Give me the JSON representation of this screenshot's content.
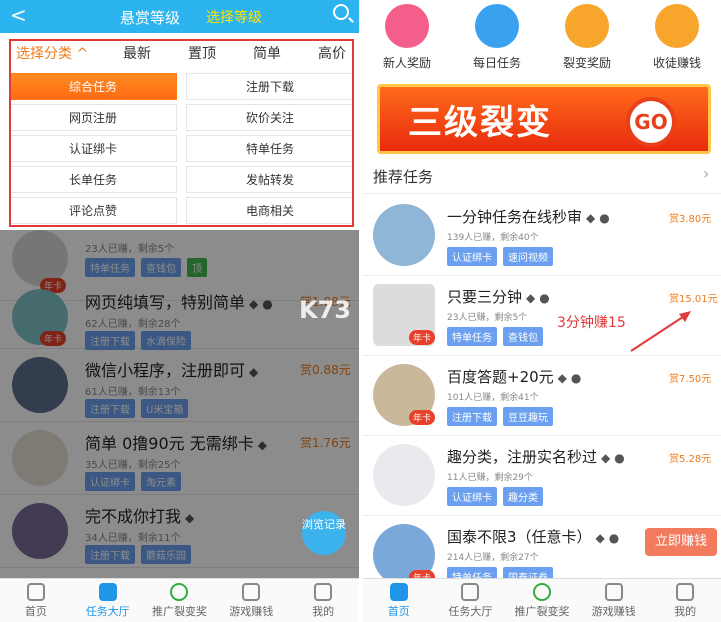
{
  "left": {
    "header": {
      "back": "<",
      "title": "悬赏等级",
      "sub": "选择等级"
    },
    "sort": {
      "category": "选择分类 ^",
      "items": [
        "最新",
        "置顶",
        "简单",
        "高价"
      ]
    },
    "categories": [
      "综合任务",
      "注册下载",
      "网页注册",
      "砍价关注",
      "认证绑卡",
      "特单任务",
      "长单任务",
      "发帖转发",
      "评论点赞",
      "电商相关"
    ],
    "tasks": [
      {
        "name": "",
        "meta": "23人已赚，剩余5个",
        "reward": "",
        "tags": [
          "特单任务",
          "查钱包",
          "顶"
        ],
        "badge": "年卡"
      },
      {
        "name": "网页纯填写，特别简单",
        "meta": "62人已赚，剩余28个",
        "reward": "赏1.88元",
        "tags": [
          "注册下载",
          "水滴保险"
        ],
        "badge": "年卡"
      },
      {
        "name": "微信小程序，注册即可",
        "meta": "61人已赚，剩余13个",
        "reward": "赏0.88元",
        "tags": [
          "注册下载",
          "U米宝箱"
        ],
        "badge": ""
      },
      {
        "name": "简单 0撸90元 无需绑卡",
        "meta": "35人已赚，剩余25个",
        "reward": "赏1.76元",
        "tags": [
          "认证绑卡",
          "淘元素"
        ],
        "badge": ""
      },
      {
        "name": "完不成你打我",
        "meta": "34人已赚，剩余11个",
        "reward": "",
        "tags": [
          "注册下载",
          "蘑菇乐园"
        ],
        "badge": ""
      }
    ],
    "float_button": "浏览记录",
    "tabbar": [
      "首页",
      "任务大厅",
      "推广裂变奖",
      "游戏赚钱",
      "我的"
    ]
  },
  "right": {
    "icons": [
      "新人奖励",
      "每日任务",
      "裂变奖励",
      "收徒赚钱"
    ],
    "banner": {
      "text": "三级裂变",
      "go": "GO"
    },
    "recommend": "推荐任务",
    "tasks": [
      {
        "name": "一分钟任务在线秒审",
        "meta": "139人已赚，剩余40个",
        "reward": "赏3.80元",
        "tags": [
          "认证绑卡",
          "速问视频"
        ],
        "badge": ""
      },
      {
        "name": "只要三分钟",
        "meta": "23人已赚，剩余5个",
        "reward": "赏15.01元",
        "tags": [
          "特单任务",
          "查钱包"
        ],
        "badge": "年卡"
      },
      {
        "name": "百度答题+20元",
        "meta": "101人已赚，剩余41个",
        "reward": "赏7.50元",
        "tags": [
          "注册下载",
          "豆豆趣玩"
        ],
        "badge": "年卡"
      },
      {
        "name": "趣分类，注册实名秒过",
        "meta": "11人已赚，剩余29个",
        "reward": "赏5.28元",
        "tags": [
          "认证绑卡",
          "趣分类"
        ],
        "badge": ""
      },
      {
        "name": "国泰不限3（任意卡）",
        "meta": "214人已赚，剩余27个",
        "reward": "",
        "tags": [
          "特单任务",
          "国泰证券"
        ],
        "badge": "年卡"
      }
    ],
    "note": "3分钟赚15",
    "claim": "立即赚钱",
    "tabbar": [
      "首页",
      "任务大厅",
      "推广裂变奖",
      "游戏赚钱",
      "我的"
    ]
  },
  "watermark": "K73"
}
